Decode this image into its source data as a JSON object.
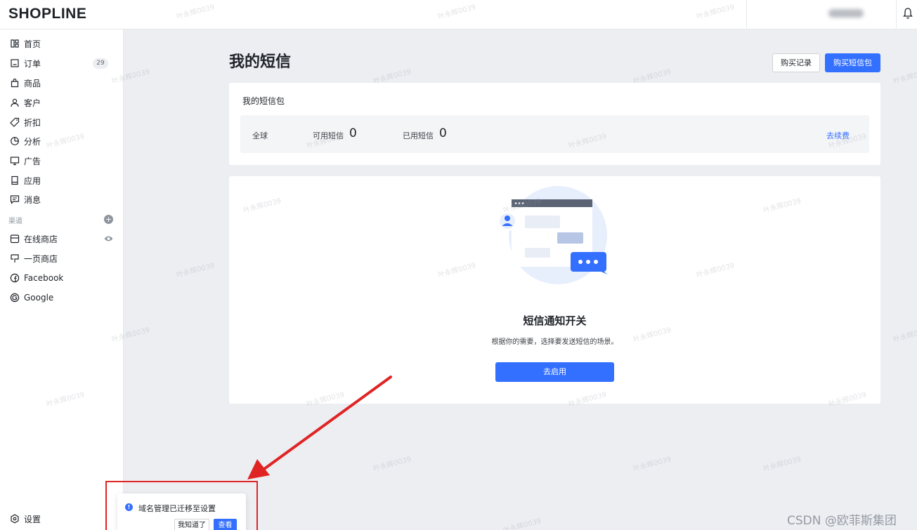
{
  "app": {
    "logo": "SHOPLINE"
  },
  "sidebar": {
    "items": [
      {
        "label": "首页",
        "icon": "home-icon"
      },
      {
        "label": "订单",
        "icon": "order-icon",
        "badge": "29"
      },
      {
        "label": "商品",
        "icon": "bag-icon"
      },
      {
        "label": "客户",
        "icon": "user-icon"
      },
      {
        "label": "折扣",
        "icon": "tag-icon"
      },
      {
        "label": "分析",
        "icon": "pie-chart-icon"
      },
      {
        "label": "广告",
        "icon": "monitor-icon"
      },
      {
        "label": "应用",
        "icon": "app-icon"
      },
      {
        "label": "消息",
        "icon": "message-icon"
      }
    ],
    "channels_label": "渠道",
    "channels": [
      {
        "label": "在线商店",
        "icon": "store-icon"
      },
      {
        "label": "一页商店",
        "icon": "one-page-icon"
      },
      {
        "label": "Facebook",
        "icon": "facebook-icon"
      },
      {
        "label": "Google",
        "icon": "google-icon"
      }
    ],
    "settings_label": "设置"
  },
  "main": {
    "title": "我的短信",
    "purchase_history_label": "购买记录",
    "buy_package_label": "购买短信包",
    "package_card": {
      "title": "我的短信包",
      "region": "全球",
      "available_label": "可用短信",
      "available_value": "0",
      "used_label": "已用短信",
      "used_value": "0",
      "renew_label": "去续费"
    },
    "empty_state": {
      "title": "短信通知开关",
      "description": "根据你的需要，选择要发送短信的场景。",
      "button_label": "去启用"
    }
  },
  "toast": {
    "message": "域名管理已迁移至设置",
    "dismiss_label": "我知道了",
    "view_label": "查看"
  },
  "watermark": {
    "text": "叶永辉0039",
    "credit": "CSDN @欧菲斯集团"
  },
  "colors": {
    "primary": "#3370ff",
    "annotation_red": "#e02424"
  }
}
